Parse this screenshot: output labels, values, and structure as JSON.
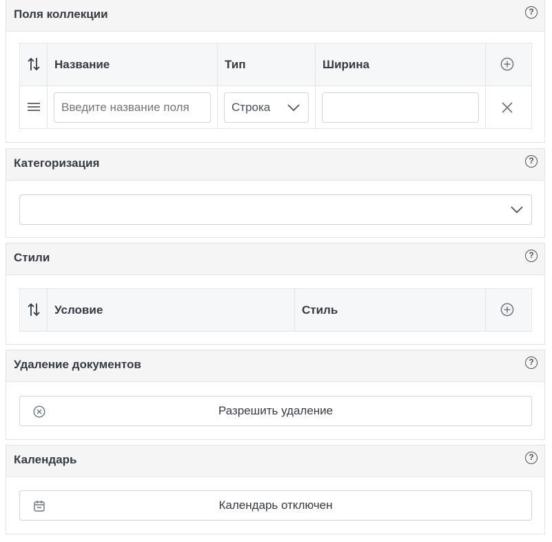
{
  "sections": {
    "fields": {
      "title": "Поля коллекции",
      "columns": {
        "name": "Название",
        "type": "Тип",
        "width": "Ширина"
      },
      "row": {
        "name_placeholder": "Введите название поля",
        "type_value": "Строка",
        "width_value": ""
      }
    },
    "categorization": {
      "title": "Категоризация",
      "select_value": ""
    },
    "styles": {
      "title": "Стили",
      "columns": {
        "condition": "Условие",
        "style": "Стиль"
      }
    },
    "deletion": {
      "title": "Удаление документов",
      "button_label": "Разрешить удаление"
    },
    "calendar": {
      "title": "Календарь",
      "button_label": "Календарь отключен"
    }
  },
  "icons": {
    "help": "question-circle-icon",
    "sort": "sort-arrows-icon",
    "add": "plus-circle-icon",
    "drag": "drag-handle-icon",
    "remove": "close-icon",
    "dropdown": "chevron-down-icon",
    "deny": "x-circle-icon",
    "calendar": "calendar-icon"
  },
  "colors": {
    "header_bg": "#f5f5f5",
    "border": "#dee2e6",
    "text": "#343a40",
    "icon": "#6c757d"
  }
}
